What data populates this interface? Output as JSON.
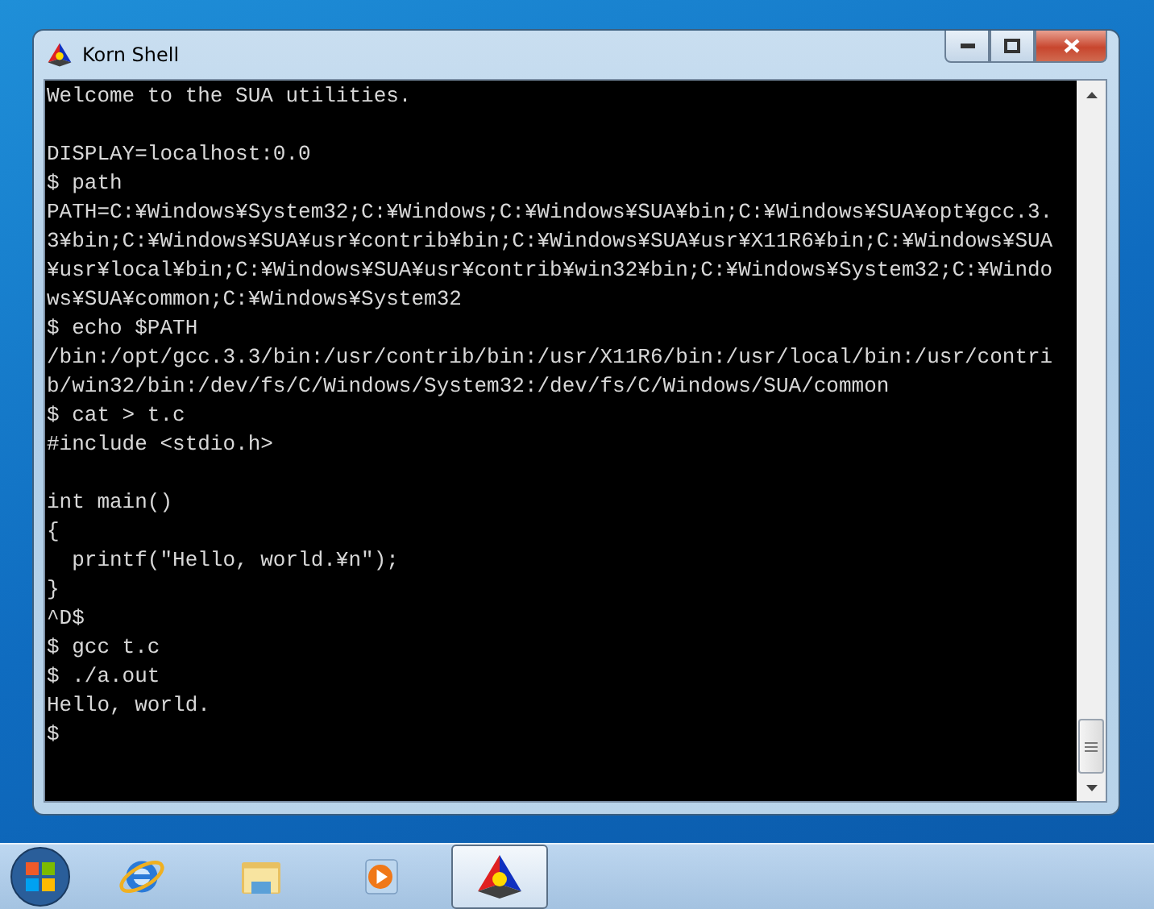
{
  "window": {
    "title": "Korn Shell"
  },
  "terminal": {
    "blocks": [
      [
        "Welcome to the SUA utilities."
      ],
      [
        "DISPLAY=localhost:0.0",
        "$ path",
        "PATH=C:¥Windows¥System32;C:¥Windows;C:¥Windows¥SUA¥bin;C:¥Windows¥SUA¥opt¥gcc.3.",
        "3¥bin;C:¥Windows¥SUA¥usr¥contrib¥bin;C:¥Windows¥SUA¥usr¥X11R6¥bin;C:¥Windows¥SUA",
        "¥usr¥local¥bin;C:¥Windows¥SUA¥usr¥contrib¥win32¥bin;C:¥Windows¥System32;C:¥Windo",
        "ws¥SUA¥common;C:¥Windows¥System32",
        "$ echo $PATH",
        "/bin:/opt/gcc.3.3/bin:/usr/contrib/bin:/usr/X11R6/bin:/usr/local/bin:/usr/contri",
        "b/win32/bin:/dev/fs/C/Windows/System32:/dev/fs/C/Windows/SUA/common",
        "$ cat > t.c",
        "#include <stdio.h>"
      ],
      [
        "int main()",
        "{",
        "  printf(\"Hello, world.¥n\");",
        "}",
        "^D$",
        "$ gcc t.c",
        "$ ./a.out",
        "Hello, world.",
        "$"
      ]
    ]
  },
  "taskbar": {
    "items": [
      {
        "kind": "ie",
        "selected": false
      },
      {
        "kind": "folder",
        "selected": false
      },
      {
        "kind": "media",
        "selected": false
      },
      {
        "kind": "shell",
        "selected": true
      }
    ]
  }
}
